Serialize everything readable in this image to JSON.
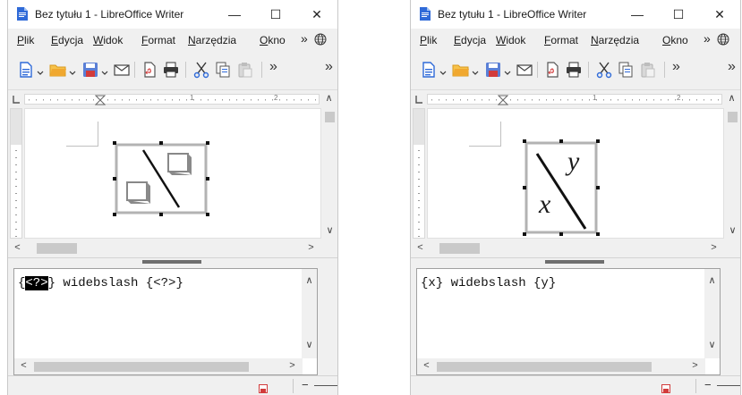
{
  "windows": [
    {
      "id": "left",
      "title": "Bez tytułu 1 - LibreOffice Writer",
      "controls": {
        "minimize": "—",
        "maximize": "☐",
        "close": "✕"
      },
      "menu": [
        {
          "pre": "",
          "u": "P",
          "post": "lik"
        },
        {
          "pre": "",
          "u": "E",
          "post": "dycja"
        },
        {
          "pre": "",
          "u": "W",
          "post": "idok"
        },
        {
          "pre": "",
          "u": "F",
          "post": "ormat"
        },
        {
          "pre": "",
          "u": "N",
          "post": "arzędzia"
        },
        {
          "pre": "",
          "u": "O",
          "post": "kno"
        }
      ],
      "menu_more": "»",
      "toolbar_more": "»",
      "ruler_numbers": [
        "1",
        "2"
      ],
      "formula": {
        "before": "{",
        "selected": "<?>",
        "after": "} widebslash {<?>}"
      },
      "preview": {
        "kind": "placeholder"
      }
    },
    {
      "id": "right",
      "title": "Bez tytułu 1 - LibreOffice Writer",
      "controls": {
        "minimize": "—",
        "maximize": "☐",
        "close": "✕"
      },
      "menu": [
        {
          "pre": "",
          "u": "P",
          "post": "lik"
        },
        {
          "pre": "",
          "u": "E",
          "post": "dycja"
        },
        {
          "pre": "",
          "u": "W",
          "post": "idok"
        },
        {
          "pre": "",
          "u": "F",
          "post": "ormat"
        },
        {
          "pre": "",
          "u": "N",
          "post": "arzędzia"
        },
        {
          "pre": "",
          "u": "O",
          "post": "kno"
        }
      ],
      "menu_more": "»",
      "toolbar_more": "»",
      "ruler_numbers": [
        "1",
        "2"
      ],
      "formula": {
        "before": "{x} widebslash {y}",
        "selected": "",
        "after": ""
      },
      "preview": {
        "kind": "rendered",
        "left_var": "x",
        "right_var": "y"
      }
    }
  ],
  "icons": {
    "app": "writer-document-icon",
    "new": "new-document-icon",
    "open": "open-folder-icon",
    "save": "save-icon",
    "mail": "email-icon",
    "pdf": "export-pdf-icon",
    "print": "print-icon",
    "cut": "cut-icon",
    "copy": "copy-icon",
    "paste": "paste-icon",
    "globe": "globe-icon",
    "status_save": "document-modified-icon"
  },
  "colors": {
    "accent_blue": "#2f6ad8",
    "folder_orange": "#f0a830",
    "save_red": "#d23b3b",
    "selection": "#000000"
  }
}
